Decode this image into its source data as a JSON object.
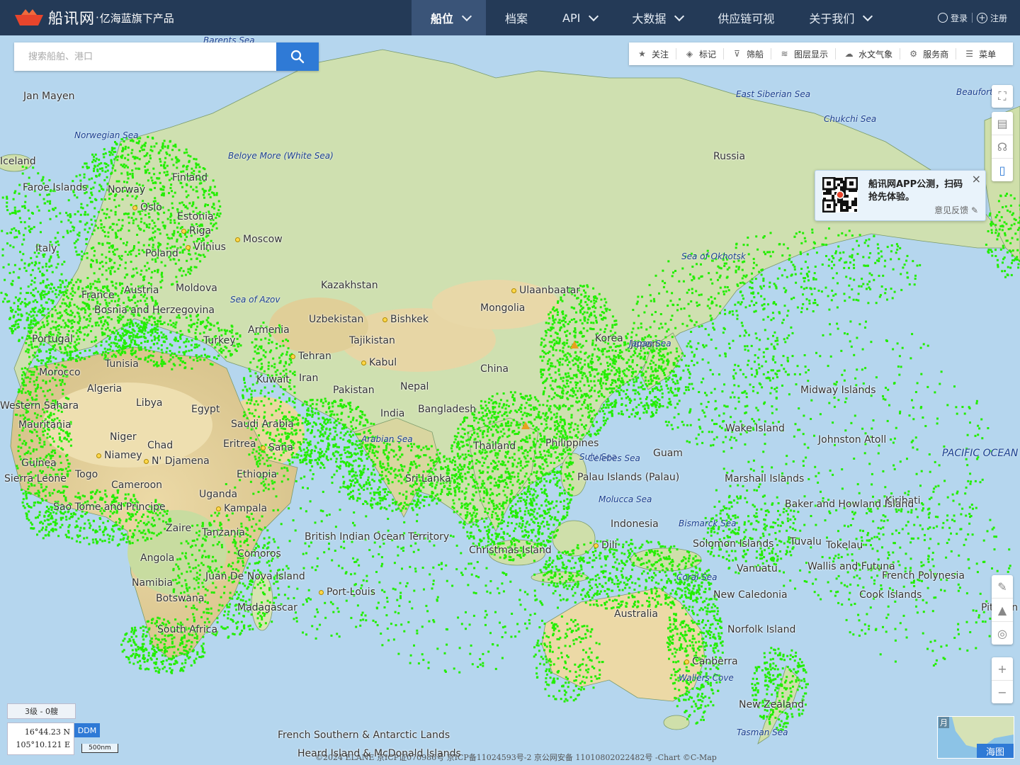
{
  "header": {
    "brand": "船讯网",
    "dot": "·",
    "subtitle": "亿海蓝旗下产品",
    "nav": [
      {
        "label": "船位",
        "dropdown": true,
        "active": true
      },
      {
        "label": "档案",
        "dropdown": false
      },
      {
        "label": "API",
        "dropdown": true
      },
      {
        "label": "大数据",
        "dropdown": true
      },
      {
        "label": "供应链可视",
        "dropdown": false
      },
      {
        "label": "关于我们",
        "dropdown": true
      }
    ],
    "login": "登录",
    "register": "注册"
  },
  "search": {
    "placeholder": "搜索船舶、港口"
  },
  "toolbar": [
    {
      "label": "关注",
      "icon": "star-icon"
    },
    {
      "label": "标记",
      "icon": "tag-icon"
    },
    {
      "label": "筛船",
      "icon": "filter-icon"
    },
    {
      "label": "图层显示",
      "icon": "layers-icon"
    },
    {
      "label": "水文气象",
      "icon": "weather-icon"
    },
    {
      "label": "服务商",
      "icon": "service-icon"
    },
    {
      "label": "菜单",
      "icon": "menu-icon"
    }
  ],
  "popup": {
    "text": "船讯网APP公测，扫码抢先体验。",
    "feedback": "意见反馈",
    "close": "×"
  },
  "status": {
    "zoom_level": "3级 - 0艘",
    "lat": "16°44.23 N",
    "lon": "105°10.121 E",
    "format_button": "DDM",
    "scale": "500nm"
  },
  "footer": "©2024 ELANE 京ICP证070986号 京ICP备11024593号-2   京公网安备 11010802022482号  -Chart ©C-Map",
  "minimap": {
    "layer_label": "海图",
    "top_text": "月"
  },
  "colors": {
    "header_bg": "#243a57",
    "ship_dot": "#22ee00",
    "accent": "#2f7ad6"
  },
  "map_labels": {
    "places": [
      {
        "name": "Jan Mayen"
      },
      {
        "name": "Faroe Islands"
      },
      {
        "name": "Norway"
      },
      {
        "name": "Finland"
      },
      {
        "name": "Oslo"
      },
      {
        "name": "Estonia"
      },
      {
        "name": "Riga"
      },
      {
        "name": "Vilnius"
      },
      {
        "name": "Moscow"
      },
      {
        "name": "Poland"
      },
      {
        "name": "Moldova"
      },
      {
        "name": "France"
      },
      {
        "name": "Austria"
      },
      {
        "name": "Bosnia and Herzegovina"
      },
      {
        "name": "Portugal"
      },
      {
        "name": "Turkey"
      },
      {
        "name": "Armenia"
      },
      {
        "name": "Kazakhstan"
      },
      {
        "name": "Mongolia"
      },
      {
        "name": "Ulaanbaatar"
      },
      {
        "name": "Uzbekistan"
      },
      {
        "name": "Bishkek"
      },
      {
        "name": "Tajikistan"
      },
      {
        "name": "Tehran"
      },
      {
        "name": "Kabul"
      },
      {
        "name": "China"
      },
      {
        "name": "Iran"
      },
      {
        "name": "Pakistan"
      },
      {
        "name": "Nepal"
      },
      {
        "name": "India"
      },
      {
        "name": "Bangladesh"
      },
      {
        "name": "Thailand"
      },
      {
        "name": "Kuwait"
      },
      {
        "name": "Saudi Arabia"
      },
      {
        "name": "Eritrea"
      },
      {
        "name": "Sana"
      },
      {
        "name": "Ethiopia"
      },
      {
        "name": "Morocco"
      },
      {
        "name": "Algeria"
      },
      {
        "name": "Libya"
      },
      {
        "name": "Egypt"
      },
      {
        "name": "Tunisia"
      },
      {
        "name": "Western Sahara"
      },
      {
        "name": "Mauritania"
      },
      {
        "name": "Niger"
      },
      {
        "name": "Chad"
      },
      {
        "name": "Niamey"
      },
      {
        "name": "N' Djamena"
      },
      {
        "name": "Guinea"
      },
      {
        "name": "Sierra Leone"
      },
      {
        "name": "Togo"
      },
      {
        "name": "Cameroon"
      },
      {
        "name": "Uganda"
      },
      {
        "name": "Kampala"
      },
      {
        "name": "Sao Tome and Principe"
      },
      {
        "name": "Zaire"
      },
      {
        "name": "Tanzania"
      },
      {
        "name": "Angola"
      },
      {
        "name": "Comoros"
      },
      {
        "name": "Namibia"
      },
      {
        "name": "Botswana"
      },
      {
        "name": "Madagascar"
      },
      {
        "name": "South Africa"
      },
      {
        "name": "Juan De Nova Island"
      },
      {
        "name": "Port-Louis"
      },
      {
        "name": "British Indian Ocean Territory"
      },
      {
        "name": "Christmas Island"
      },
      {
        "name": "Indonesia"
      },
      {
        "name": "Dili"
      },
      {
        "name": "Australia"
      },
      {
        "name": "Canberra"
      },
      {
        "name": "New Zealand"
      },
      {
        "name": "New Caledonia"
      },
      {
        "name": "Norfolk Island"
      },
      {
        "name": "Vanuatu"
      },
      {
        "name": "Solomon Islands"
      },
      {
        "name": "Tuvalu"
      },
      {
        "name": "Tokelau"
      },
      {
        "name": "Wallis and Futuna"
      },
      {
        "name": "French Polynesia"
      },
      {
        "name": "Cook Islands"
      },
      {
        "name": "Kiribati"
      },
      {
        "name": "Baker and Howland Island"
      },
      {
        "name": "Marshall Islands"
      },
      {
        "name": "Wake Island"
      },
      {
        "name": "Johnston Atoll"
      },
      {
        "name": "Midway Islands"
      },
      {
        "name": "Guam"
      },
      {
        "name": "Palau Islands (Palau)"
      },
      {
        "name": "Philippines"
      },
      {
        "name": "Russia"
      },
      {
        "name": "French Southern & Antarctic Lands"
      },
      {
        "name": "Heard Island & McDonald Islands"
      },
      {
        "name": "Iceland"
      },
      {
        "name": "Italy"
      },
      {
        "name": "Korea"
      },
      {
        "name": "Japan"
      },
      {
        "name": "Sri Lanka"
      },
      {
        "name": "Pitcairn"
      }
    ],
    "seas": [
      {
        "name": "Barents Sea"
      },
      {
        "name": "Norwegian Sea"
      },
      {
        "name": "Beloye More (White Sea)"
      },
      {
        "name": "East Siberian Sea"
      },
      {
        "name": "Chukchi Sea"
      },
      {
        "name": "Beaufort"
      },
      {
        "name": "Sea of Okhotsk"
      },
      {
        "name": "Sea of Azov"
      },
      {
        "name": "Japan Sea"
      },
      {
        "name": "Arabian Sea"
      },
      {
        "name": "Sulu Sea"
      },
      {
        "name": "Celebes Sea"
      },
      {
        "name": "Bismarck Sea"
      },
      {
        "name": "Coral Sea"
      },
      {
        "name": "Tasman Sea"
      },
      {
        "name": "PACIFIC OCEAN"
      },
      {
        "name": "Wallers Cove"
      },
      {
        "name": "Molucca Sea"
      }
    ]
  }
}
